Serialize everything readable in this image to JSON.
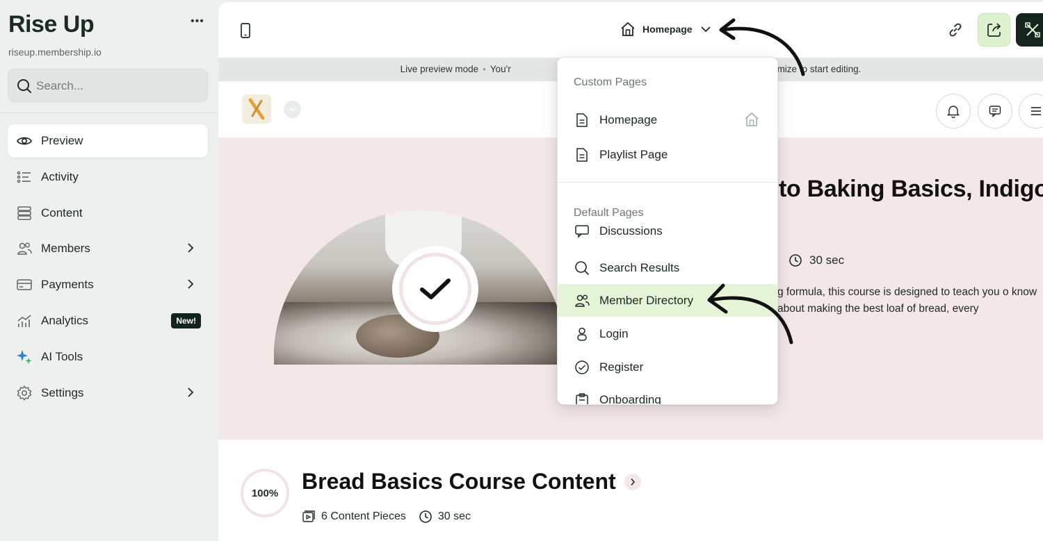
{
  "sidebar": {
    "brand": "Rise Up",
    "more": "•••",
    "url": "riseup.membership.io",
    "search_placeholder": "Search...",
    "items": [
      {
        "label": "Preview"
      },
      {
        "label": "Activity"
      },
      {
        "label": "Content"
      },
      {
        "label": "Members"
      },
      {
        "label": "Payments"
      },
      {
        "label": "Analytics",
        "badge": "New!"
      },
      {
        "label": "AI Tools"
      },
      {
        "label": "Settings"
      }
    ]
  },
  "topbar": {
    "page_selector": "Homepage"
  },
  "preview_bar": {
    "mode": "Live preview mode",
    "message_start": "You'r",
    "message_end": "Customize to start editing."
  },
  "hero": {
    "title": "to Baking Basics, Indigo",
    "duration": "30 sec",
    "description": "g formula, this course is designed to teach you o know about making the best loaf of bread, every"
  },
  "course": {
    "progress": "100%",
    "title": "Bread Basics Course Content",
    "pieces": "6 Content Pieces",
    "duration": "30 sec"
  },
  "dropdown": {
    "custom_heading": "Custom Pages",
    "custom_pages": [
      {
        "label": "Homepage"
      },
      {
        "label": "Playlist Page"
      }
    ],
    "default_heading": "Default Pages",
    "default_pages": [
      {
        "label": "Discussions"
      },
      {
        "label": "Search Results"
      },
      {
        "label": "Member Directory"
      },
      {
        "label": "Login"
      },
      {
        "label": "Register"
      },
      {
        "label": "Onboarding"
      }
    ]
  },
  "colors": {
    "sidebar_bg": "#eef0ef",
    "brand_dark": "#13241c",
    "hero_bg": "#f4e7e7",
    "highlight": "#e5f4d6",
    "share_bg": "#dff2cf"
  }
}
